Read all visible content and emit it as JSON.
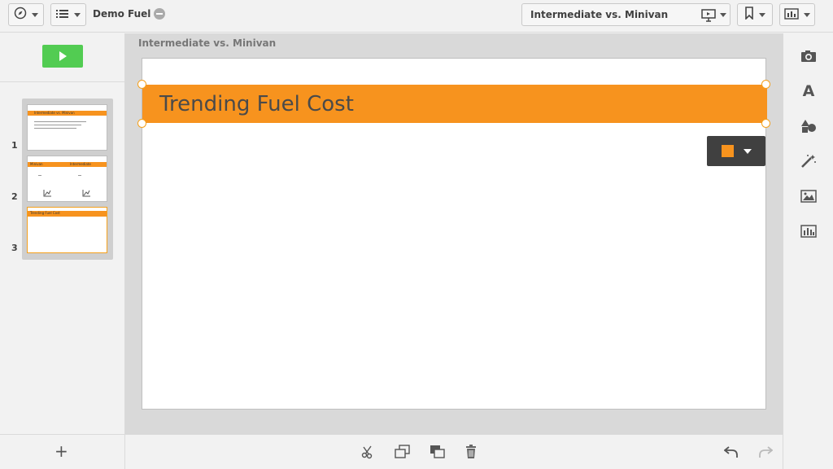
{
  "header": {
    "app_title": "Demo Fuel",
    "story_name": "Intermediate vs. Minivan"
  },
  "left_panel": {
    "slides": [
      {
        "number": "1",
        "title": "Intermediate vs. Minivan"
      },
      {
        "number": "2",
        "col_left": "Minivan",
        "col_right": "Intermediate"
      },
      {
        "number": "3",
        "title": "Trending Fuel Cost"
      }
    ],
    "add_label": "+"
  },
  "canvas": {
    "breadcrumb": "Intermediate vs. Minivan",
    "slide_title": "Trending Fuel Cost"
  },
  "colors": {
    "accent": "#f7931e",
    "play": "#52cc52",
    "popover": "#404040"
  },
  "icons": {
    "left_toolbar": [
      "compass-icon",
      "list-icon"
    ],
    "story_toolbar": [
      "present-icon",
      "bookmark-icon",
      "snapshot-library-icon"
    ],
    "bottom_toolbar": [
      "cut-icon",
      "duplicate-icon",
      "layer-icon",
      "delete-icon",
      "undo-icon",
      "redo-icon"
    ],
    "right_toolbar": [
      "camera-icon",
      "text-icon",
      "shapes-icon",
      "effects-icon",
      "image-icon",
      "sheet-icon"
    ]
  }
}
